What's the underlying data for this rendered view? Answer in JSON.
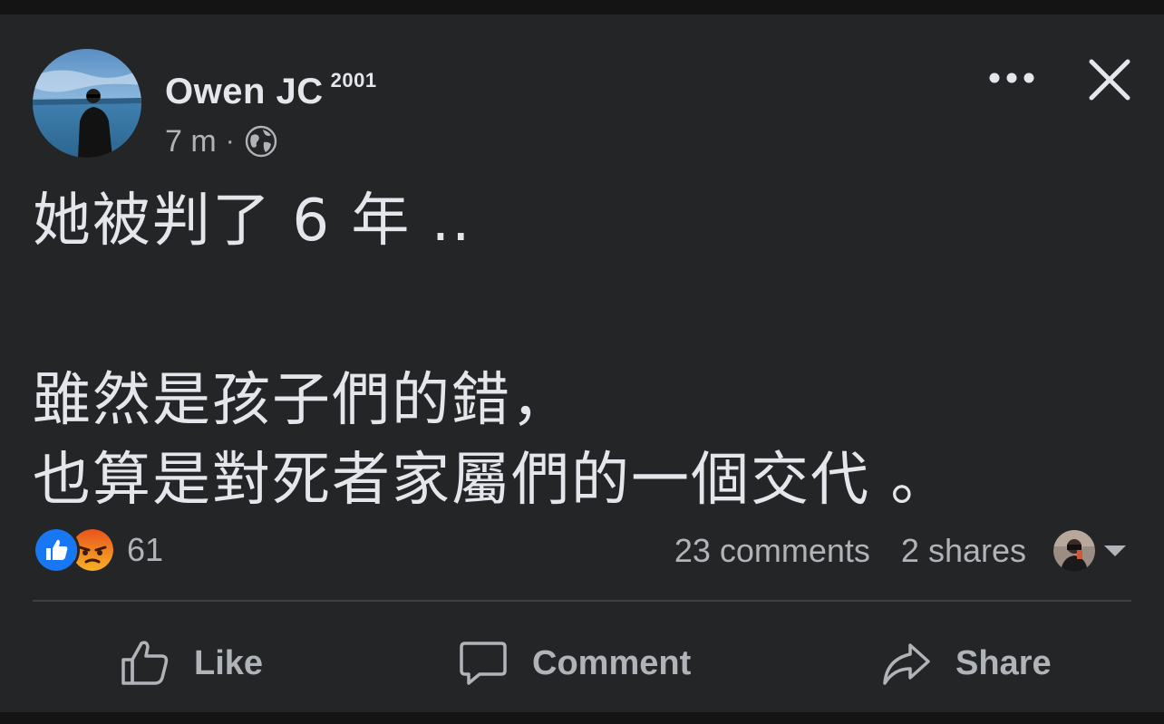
{
  "post": {
    "author": "Owen JC",
    "author_badge": "2001",
    "time": "7 m",
    "separator": "·",
    "privacy_icon": "globe-icon",
    "body_lines": [
      "她被判了 6 年 ..",
      "",
      "雖然是孩子們的錯，",
      "也算是對死者家屬們的一個交代 。"
    ]
  },
  "header": {
    "more_icon": "more-options-icon",
    "close_icon": "close-icon"
  },
  "reactions": {
    "icons": [
      "like-reaction-icon",
      "angry-reaction-icon"
    ],
    "count": "61"
  },
  "stats": {
    "comments": "23 comments",
    "shares": "2 shares"
  },
  "actions": {
    "like": "Like",
    "comment": "Comment",
    "share": "Share"
  },
  "colors": {
    "background": "#242526",
    "primary_text": "#e4e6eb",
    "secondary_text": "#b0b3b8",
    "like_blue": "#1877f2",
    "angry_orange": "#f25c19"
  }
}
